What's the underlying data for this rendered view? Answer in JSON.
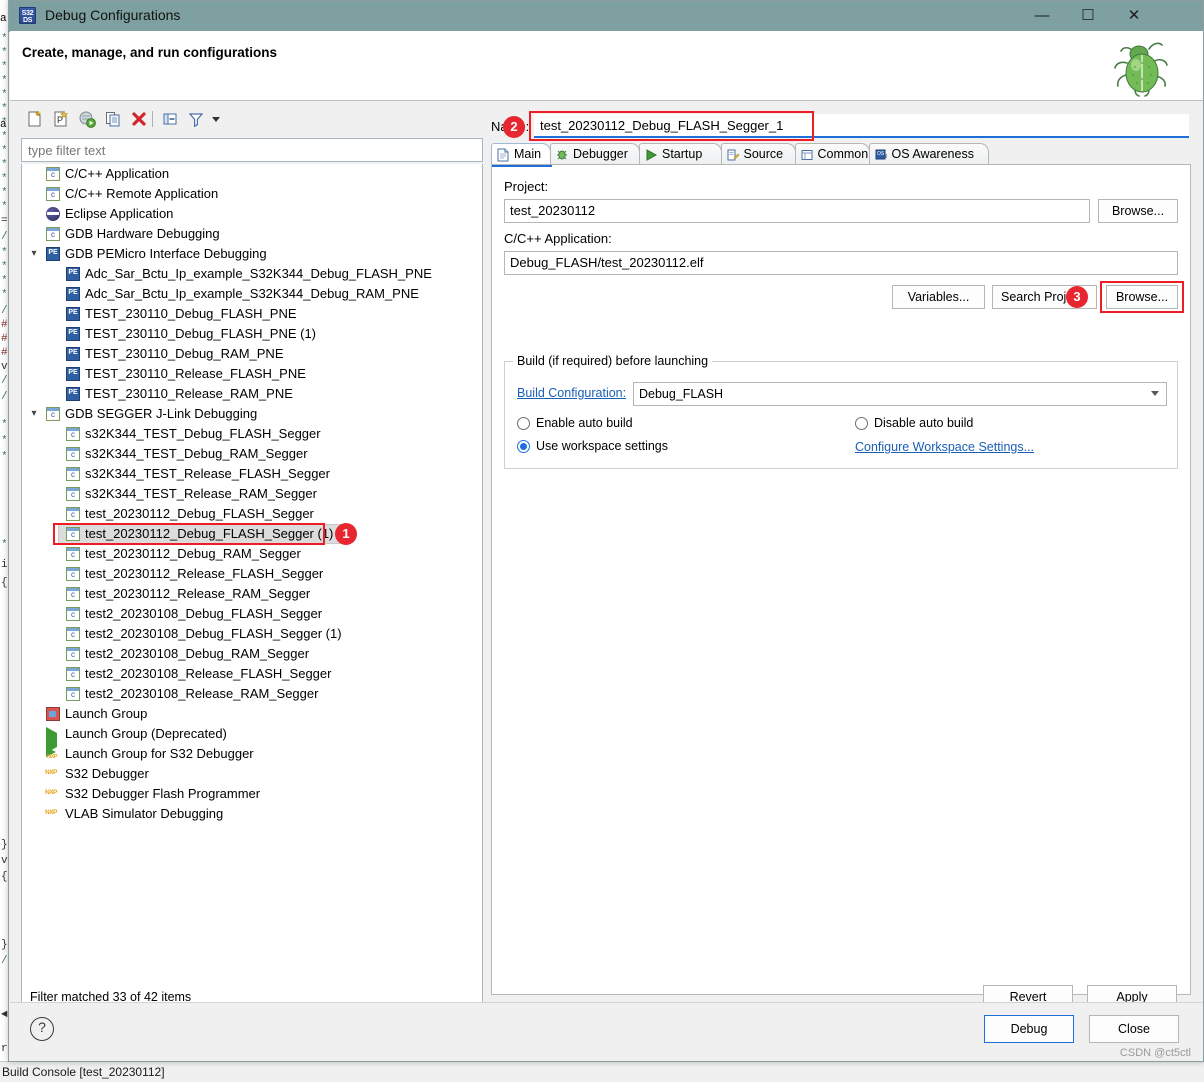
{
  "window": {
    "title": "Debug Configurations",
    "app_icon": "s32ds-icon",
    "minimize_label": "—",
    "maximize_label": "☐",
    "close_label": "✕"
  },
  "header": {
    "title": "Create, manage, and run configurations",
    "decor_icon": "green-bug-icon"
  },
  "toolbar": {
    "icons": [
      {
        "name": "new-configuration-icon",
        "title": "New launch configuration"
      },
      {
        "name": "new-prototype-icon",
        "title": "New launch configuration prototype"
      },
      {
        "name": "export-icon",
        "title": "Export"
      },
      {
        "name": "duplicate-icon",
        "title": "Duplicate"
      },
      {
        "name": "delete-icon",
        "title": "Delete"
      },
      {
        "name": "collapse-all-icon",
        "title": "Collapse All"
      },
      {
        "name": "filter-icon",
        "title": "Filter launch configurations"
      },
      {
        "name": "view-menu-icon",
        "title": "View Menu"
      }
    ]
  },
  "filter": {
    "placeholder": "type filter text",
    "value": "",
    "status": "Filter matched 33 of 42 items"
  },
  "tree": {
    "items": [
      {
        "label": "C/C++ Application",
        "icon": "c-app-icon",
        "depth": 1,
        "twisty": "",
        "selected": false
      },
      {
        "label": "C/C++ Remote Application",
        "icon": "c-app-icon",
        "depth": 1,
        "twisty": "",
        "selected": false
      },
      {
        "label": "Eclipse Application",
        "icon": "eclipse-icon",
        "depth": 1,
        "twisty": "",
        "selected": false
      },
      {
        "label": "GDB Hardware Debugging",
        "icon": "c-app-icon",
        "depth": 1,
        "twisty": "",
        "selected": false
      },
      {
        "label": "GDB PEMicro Interface Debugging",
        "icon": "pemicro-icon",
        "depth": 1,
        "twisty": "expanded",
        "selected": false
      },
      {
        "label": "Adc_Sar_Bctu_Ip_example_S32K344_Debug_FLASH_PNE",
        "icon": "pemicro-icon",
        "depth": 2,
        "twisty": "",
        "selected": false
      },
      {
        "label": "Adc_Sar_Bctu_Ip_example_S32K344_Debug_RAM_PNE",
        "icon": "pemicro-icon",
        "depth": 2,
        "twisty": "",
        "selected": false
      },
      {
        "label": "TEST_230110_Debug_FLASH_PNE",
        "icon": "pemicro-icon",
        "depth": 2,
        "twisty": "",
        "selected": false
      },
      {
        "label": "TEST_230110_Debug_FLASH_PNE (1)",
        "icon": "pemicro-icon",
        "depth": 2,
        "twisty": "",
        "selected": false
      },
      {
        "label": "TEST_230110_Debug_RAM_PNE",
        "icon": "pemicro-icon",
        "depth": 2,
        "twisty": "",
        "selected": false
      },
      {
        "label": "TEST_230110_Release_FLASH_PNE",
        "icon": "pemicro-icon",
        "depth": 2,
        "twisty": "",
        "selected": false
      },
      {
        "label": "TEST_230110_Release_RAM_PNE",
        "icon": "pemicro-icon",
        "depth": 2,
        "twisty": "",
        "selected": false
      },
      {
        "label": "GDB SEGGER J-Link Debugging",
        "icon": "c-app-icon",
        "depth": 1,
        "twisty": "expanded",
        "selected": false
      },
      {
        "label": "s32K344_TEST_Debug_FLASH_Segger",
        "icon": "c-app-icon",
        "depth": 2,
        "twisty": "",
        "selected": false
      },
      {
        "label": "s32K344_TEST_Debug_RAM_Segger",
        "icon": "c-app-icon",
        "depth": 2,
        "twisty": "",
        "selected": false
      },
      {
        "label": "s32K344_TEST_Release_FLASH_Segger",
        "icon": "c-app-icon",
        "depth": 2,
        "twisty": "",
        "selected": false
      },
      {
        "label": "s32K344_TEST_Release_RAM_Segger",
        "icon": "c-app-icon",
        "depth": 2,
        "twisty": "",
        "selected": false
      },
      {
        "label": "test_20230112_Debug_FLASH_Segger",
        "icon": "c-app-icon",
        "depth": 2,
        "twisty": "",
        "selected": false
      },
      {
        "label": "test_20230112_Debug_FLASH_Segger (1)",
        "icon": "c-app-icon",
        "depth": 2,
        "twisty": "",
        "selected": true
      },
      {
        "label": "test_20230112_Debug_RAM_Segger",
        "icon": "c-app-icon",
        "depth": 2,
        "twisty": "",
        "selected": false
      },
      {
        "label": "test_20230112_Release_FLASH_Segger",
        "icon": "c-app-icon",
        "depth": 2,
        "twisty": "",
        "selected": false
      },
      {
        "label": "test_20230112_Release_RAM_Segger",
        "icon": "c-app-icon",
        "depth": 2,
        "twisty": "",
        "selected": false
      },
      {
        "label": "test2_20230108_Debug_FLASH_Segger",
        "icon": "c-app-icon",
        "depth": 2,
        "twisty": "",
        "selected": false
      },
      {
        "label": "test2_20230108_Debug_FLASH_Segger (1)",
        "icon": "c-app-icon",
        "depth": 2,
        "twisty": "",
        "selected": false
      },
      {
        "label": "test2_20230108_Debug_RAM_Segger",
        "icon": "c-app-icon",
        "depth": 2,
        "twisty": "",
        "selected": false
      },
      {
        "label": "test2_20230108_Release_FLASH_Segger",
        "icon": "c-app-icon",
        "depth": 2,
        "twisty": "",
        "selected": false
      },
      {
        "label": "test2_20230108_Release_RAM_Segger",
        "icon": "c-app-icon",
        "depth": 2,
        "twisty": "",
        "selected": false
      },
      {
        "label": "Launch Group",
        "icon": "launch-group-icon",
        "depth": 1,
        "twisty": "",
        "selected": false
      },
      {
        "label": "Launch Group (Deprecated)",
        "icon": "play-icon",
        "depth": 1,
        "twisty": "",
        "selected": false
      },
      {
        "label": "Launch Group for S32 Debugger",
        "icon": "play-nxp-icon",
        "depth": 1,
        "twisty": "",
        "selected": false
      },
      {
        "label": "S32 Debugger",
        "icon": "nxp-icon",
        "depth": 1,
        "twisty": "",
        "selected": false
      },
      {
        "label": "S32 Debugger Flash Programmer",
        "icon": "nxp-icon",
        "depth": 1,
        "twisty": "",
        "selected": false
      },
      {
        "label": "VLAB Simulator Debugging",
        "icon": "nxp-icon",
        "depth": 1,
        "twisty": "",
        "selected": false
      }
    ]
  },
  "config": {
    "name_label": "Name:",
    "name_value": "test_20230112_Debug_FLASH_Segger_1",
    "tabs": [
      {
        "label": "Main",
        "icon": "main-tab-icon",
        "active": true
      },
      {
        "label": "Debugger",
        "icon": "debugger-tab-icon",
        "active": false
      },
      {
        "label": "Startup",
        "icon": "startup-tab-icon",
        "active": false
      },
      {
        "label": "Source",
        "icon": "source-tab-icon",
        "active": false
      },
      {
        "label": "Common",
        "icon": "common-tab-icon",
        "active": false
      },
      {
        "label": "OS Awareness",
        "icon": "os-awareness-tab-icon",
        "active": false
      }
    ],
    "project_label": "Project:",
    "project_value": "test_20230112",
    "project_browse": "Browse...",
    "app_label": "C/C++ Application:",
    "app_value": "Debug_FLASH/test_20230112.elf",
    "variables_btn": "Variables...",
    "search_project_btn": "Search Proje",
    "app_browse_btn": "Browse...",
    "build_group_legend": "Build (if required) before launching",
    "build_configuration_label": "Build Configuration:",
    "build_configuration_value": "Debug_FLASH",
    "enable_auto_build": "Enable auto build",
    "disable_auto_build": "Disable auto build",
    "use_workspace_settings": "Use workspace settings",
    "configure_workspace_link": "Configure Workspace Settings...",
    "selected_build_radio": "use_workspace_settings"
  },
  "actions": {
    "revert": "Revert",
    "apply": "Apply",
    "help_icon": "question-mark-icon",
    "debug": "Debug",
    "close": "Close"
  },
  "annotations": [
    {
      "id": "1",
      "target": "selected-tree-item"
    },
    {
      "id": "2",
      "target": "name-field"
    },
    {
      "id": "3",
      "target": "app-browse-button"
    }
  ],
  "background": {
    "status_text": "Build Console [test_20230112]"
  },
  "watermark": "CSDN @ct5ctl",
  "colors": {
    "titlebar": "#7fa0a0",
    "accent_blue": "#1e6fd9",
    "annotation_red": "#ee1c25",
    "link_blue": "#1a5fb4"
  }
}
